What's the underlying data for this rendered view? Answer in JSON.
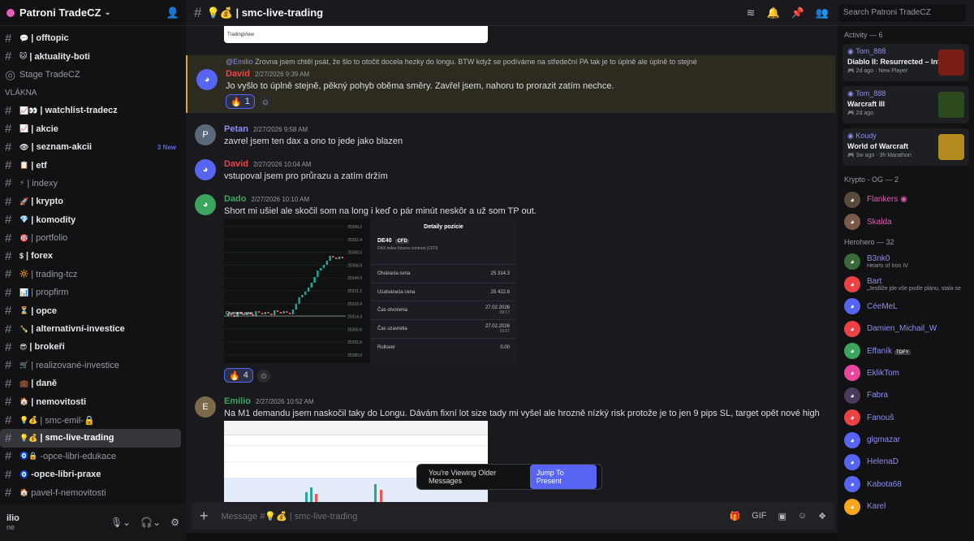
{
  "server": {
    "name": "Patroni TradeCZ"
  },
  "channels": [
    {
      "label": "| offtopic",
      "emoji": "💬",
      "bright": true
    },
    {
      "label": "| aktuality-boti",
      "emoji": "🐱",
      "bright": true
    },
    {
      "label": "Stage TradeCZ",
      "emoji": "",
      "bright": false,
      "stage": true
    },
    {
      "label": "VLÁKNA",
      "section": true
    },
    {
      "label": "| watchlist-tradecz",
      "emoji": "📈👀",
      "bright": true
    },
    {
      "label": "| akcie",
      "emoji": "📈",
      "bright": true
    },
    {
      "label": "| seznam-akcii",
      "emoji": "👁",
      "bright": true,
      "badge": "3 New"
    },
    {
      "label": "| etf",
      "emoji": "📋",
      "bright": true
    },
    {
      "label": "| indexy",
      "emoji": "⚡",
      "bright": false
    },
    {
      "label": "| krypto",
      "emoji": "🚀",
      "bright": true
    },
    {
      "label": "| komodity",
      "emoji": "💎",
      "bright": true
    },
    {
      "label": "| portfolio",
      "emoji": "🎯",
      "bright": false
    },
    {
      "label": "| forex",
      "emoji": "$",
      "bright": true
    },
    {
      "label": "| trading-tcz",
      "emoji": "🔆",
      "bright": false
    },
    {
      "label": "| propfirm",
      "emoji": "📊",
      "bright": false
    },
    {
      "label": "| opce",
      "emoji": "⏳",
      "bright": true
    },
    {
      "label": "| alternativní-investice",
      "emoji": "🍾",
      "bright": true
    },
    {
      "label": "| brokeři",
      "emoji": "😎",
      "bright": true
    },
    {
      "label": "| realizované-investice",
      "emoji": "🛒",
      "bright": false
    },
    {
      "label": "| daně",
      "emoji": "💼",
      "bright": true
    },
    {
      "label": "| nemovitosti",
      "emoji": "🏠",
      "bright": true
    },
    {
      "label": "| smc-emil-🔒",
      "emoji": "💡💰",
      "bright": false
    },
    {
      "label": "| smc-live-trading",
      "emoji": "💡💰",
      "bright": true,
      "active": true
    },
    {
      "label": "-opce-libri-edukace",
      "emoji": "🧿🔒",
      "bright": false
    },
    {
      "label": "-opce-libri-praxe",
      "emoji": "🧿",
      "bright": true
    },
    {
      "label": "pavel-f-nemovitosti",
      "emoji": "🏠",
      "bright": false
    }
  ],
  "user": {
    "name": "ilio",
    "status": "ne"
  },
  "header": {
    "title": "💡💰 | smc-live-trading",
    "search_placeholder": "Search Patroni TradeCZ"
  },
  "image_top": {
    "caption": "TradingView"
  },
  "messages": [
    {
      "reply_author": "@Emilio",
      "reply_text": "Zrovna jsem chtěl psát, že šlo to otočit docela hezky do longu. BTW když se podíváme na středeční PA tak je to úplně ale úplně to stejné",
      "author": "David",
      "time": "2/27/2026 9:39 AM",
      "text": "Jo vyšlo to úplně stejně, pěkný pohyb oběma směry. Zavřel jsem, nahoru to prorazit zatím nechce.",
      "reaction": "1"
    },
    {
      "author": "Petan",
      "time": "2/27/2026 9:58 AM",
      "text": "zavrel jsem ten dax a ono to jede jako blazen"
    },
    {
      "author": "David",
      "time": "2/27/2026 10:04 AM",
      "text": "vstupoval jsem pro průrazu a zatím držím"
    },
    {
      "author": "Dado",
      "time": "2/27/2026 10:10 AM",
      "text": "Short mi ušiel ale skočil som na long i keď o pár minút neskôr a už som TP out.",
      "reaction": "4"
    },
    {
      "author": "Emilio",
      "time": "2/27/2026 10:52 AM",
      "text": "Na M1 demandu jsem naskočil taky do Longu. Dávám fixní lot size tady mi vyšel ale hrozně nízký risk protože je to jen 9 pips SL, target opět nové high"
    }
  ],
  "chart_axis": [
    "25399.2",
    "25392.4",
    "25369.6",
    "25356.8",
    "25344.0",
    "25331.2",
    "25318.4",
    "25314.3",
    "25305.6",
    "25292.8",
    "25280.0"
  ],
  "chart_label": "Otvaracia cena",
  "position": {
    "title": "Detaily pozície",
    "symbol": "DE40",
    "type": "CFD",
    "desc": "DAX index futures contract (CFD)",
    "rows": [
      {
        "k": "Otváracia cena",
        "v": "25 314.3",
        "s": ""
      },
      {
        "k": "Uzatváracia cena",
        "v": "25 422.6",
        "s": ""
      },
      {
        "k": "Čas otvorenia",
        "v": "27.02.2026",
        "s": "09:17"
      },
      {
        "k": "Čas uzavretia",
        "v": "27.02.2026",
        "s": "10:07"
      },
      {
        "k": "Rollover",
        "v": "0.00",
        "s": ""
      }
    ]
  },
  "older_bar": {
    "text": "You're Viewing Older Messages",
    "button": "Jump To Present"
  },
  "composer": {
    "placeholder": "Message #💡💰 | smc-live-trading"
  },
  "right": {
    "activity_title": "Activity — 6",
    "activities": [
      {
        "name": "Tom_888",
        "game": "Diablo II: Resurrected – Inf...",
        "sub1": "2d ago",
        "sub2": "New Player",
        "color": "#7a1d12"
      },
      {
        "name": "Tom_888",
        "game": "Warcraft III",
        "sub1": "2d ago",
        "sub2": "",
        "color": "#2c4a1e"
      },
      {
        "name": "Koudy",
        "game": "World of Warcraft",
        "sub1": "3w ago",
        "sub2": "3h Marathon",
        "color": "#b58a1f"
      }
    ],
    "group1": "Krypto - OG — 2",
    "group1_members": [
      {
        "name": "Flankers ◉",
        "sub": "",
        "color": "#e35cb5",
        "av": "#5a4a3a"
      },
      {
        "name": "Skalda",
        "sub": "",
        "color": "#e35cb5",
        "av": "#7a5a4a"
      }
    ],
    "group2": "Herohero — 32",
    "group2_members": [
      {
        "name": "B3nk0",
        "sub": "Hearts of Iron IV",
        "av": "#3a6a3a"
      },
      {
        "name": "Bart",
        "sub": "„Jestliže jde vše podle plánu, stala se",
        "av": "#ed4245"
      },
      {
        "name": "CéeMeL",
        "sub": "",
        "av": "#5865f2"
      },
      {
        "name": "Damien_Michail_W",
        "sub": "",
        "av": "#ed4245"
      },
      {
        "name": "Effaník",
        "sub": "",
        "tag": "TDFY",
        "av": "#3ba55d"
      },
      {
        "name": "EklikTom",
        "sub": "",
        "av": "#eb459e"
      },
      {
        "name": "Fabra",
        "sub": "",
        "av": "#4a3a5a"
      },
      {
        "name": "Fanouš",
        "sub": "",
        "av": "#ed4245"
      },
      {
        "name": "glgmazar",
        "sub": "",
        "av": "#5865f2"
      },
      {
        "name": "HelenaD",
        "sub": "",
        "av": "#5865f2"
      },
      {
        "name": "Kabota68",
        "sub": "",
        "av": "#5865f2"
      },
      {
        "name": "Karel",
        "sub": "",
        "av": "#faa61a"
      }
    ]
  }
}
